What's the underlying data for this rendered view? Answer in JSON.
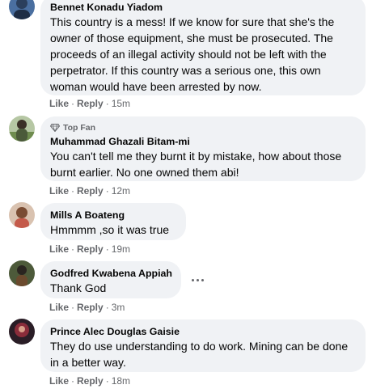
{
  "comments": [
    {
      "author": "Bennet Konadu Yiadom",
      "text": "This country is a mess! If we know for sure that she's the owner of those equipment, she must be prosecuted. The proceeds of an illegal activity should not be left with the perpetrator. If this country was a serious one, this own woman would have been arrested by now.",
      "like": "Like",
      "reply": "Reply",
      "separator": "·",
      "time": "15m"
    },
    {
      "badge": "Top Fan",
      "author": "Muhammad Ghazali Bitam-mi",
      "text": "You can't tell me they burnt it by mistake, how about those burnt earlier. No one owned them abi!",
      "like": "Like",
      "reply": "Reply",
      "separator": "·",
      "time": "12m"
    },
    {
      "author": "Mills A Boateng",
      "text": "Hmmmm ,so it was true",
      "like": "Like",
      "reply": "Reply",
      "separator": "·",
      "time": "19m"
    },
    {
      "author": "Godfred Kwabena Appiah",
      "text": "Thank God",
      "like": "Like",
      "reply": "Reply",
      "separator": "·",
      "time": "3m"
    },
    {
      "author": "Prince Alec Douglas Gaisie",
      "text": "They do use understanding to do work. Mining can be done in a better way.",
      "like": "Like",
      "reply": "Reply",
      "separator": "·",
      "time": "18m"
    }
  ],
  "colors": {
    "bubble": "#f0f2f5",
    "secondary_text": "#65676b",
    "primary_text": "#050505"
  },
  "icons": {
    "badge": "diamond-icon",
    "more": "more-options-icon"
  }
}
